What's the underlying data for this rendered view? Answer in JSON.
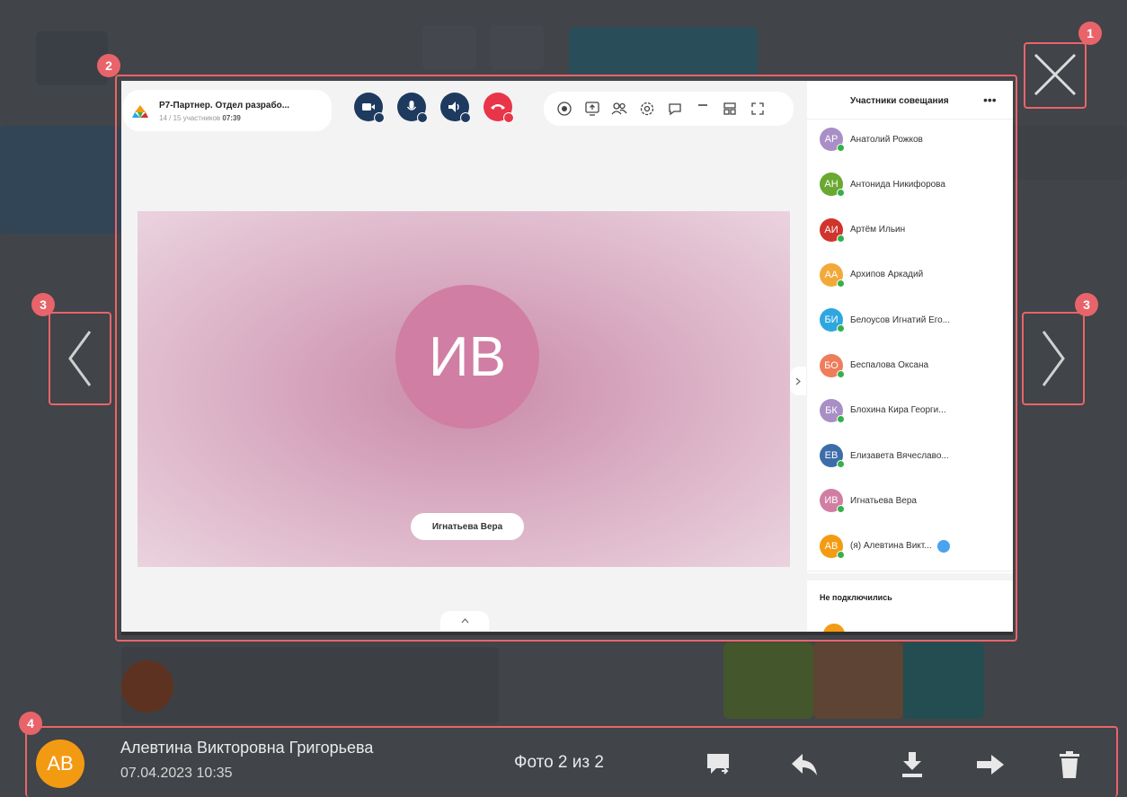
{
  "callouts": [
    "1",
    "2",
    "3",
    "3",
    "4"
  ],
  "screenshot": {
    "meeting_title": "Р7-Партнер. Отдел разрабо...",
    "meeting_count": "14 / 15 участников",
    "meeting_time": "07:39",
    "speaker_initials": "ИВ",
    "speaker_name": "Игнатьева Вера",
    "participants_header": "Участники совещания",
    "participants": [
      {
        "initials": "АР",
        "name": "Анатолий Рожков",
        "color": "#a98fc6"
      },
      {
        "initials": "АН",
        "name": "Антонида Никифорова",
        "color": "#6aa832"
      },
      {
        "initials": "АИ",
        "name": "Артём Ильин",
        "color": "#d0342c"
      },
      {
        "initials": "АА",
        "name": "Архипов Аркадий",
        "color": "#f3a93a"
      },
      {
        "initials": "БИ",
        "name": "Белоусов Игнатий Его...",
        "color": "#2ea7e0"
      },
      {
        "initials": "БО",
        "name": "Беспалова Оксана",
        "color": "#ee7d5c"
      },
      {
        "initials": "БК",
        "name": "Блохина Кира Георги...",
        "color": "#a98fc6"
      },
      {
        "initials": "ЕВ",
        "name": "Елизавета Вячеславо...",
        "color": "#3d6da8"
      },
      {
        "initials": "ИВ",
        "name": "Игнатьева Вера",
        "color": "#d07ea3"
      },
      {
        "initials": "АВ",
        "name": "(я) Алевтина Викт...",
        "color": "#f39c12"
      }
    ],
    "not_connected": "Не подключились"
  },
  "footer": {
    "avatar_initials": "AB",
    "avatar_color": "#f39a13",
    "author": "Алевтина Викторовна Григорьева",
    "datetime": "07.04.2023 10:35",
    "counter": "Фото 2 из 2"
  },
  "icons": [
    "close-icon",
    "chevron-left-icon",
    "chevron-right-icon",
    "comment-icon",
    "reply-icon",
    "download-icon",
    "forward-icon",
    "trash-icon"
  ]
}
